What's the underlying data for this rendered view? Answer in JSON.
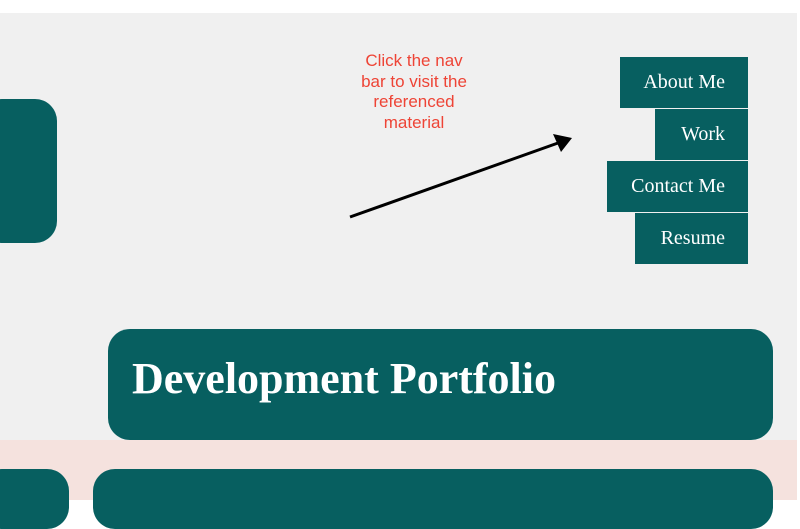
{
  "annotation": {
    "text": "Click the nav\nbar to visit the\nreferenced\nmaterial"
  },
  "nav": {
    "items": [
      {
        "label": "About Me"
      },
      {
        "label": "Work"
      },
      {
        "label": "Contact Me"
      },
      {
        "label": "Resume"
      }
    ]
  },
  "hero": {
    "title": "Development Portfolio"
  },
  "colors": {
    "teal": "#075f60",
    "background": "#f0f0f0",
    "lower_band": "#f5e2de",
    "annotation_red": "#ee4436"
  },
  "icons": {
    "arrow": "arrow-icon"
  }
}
